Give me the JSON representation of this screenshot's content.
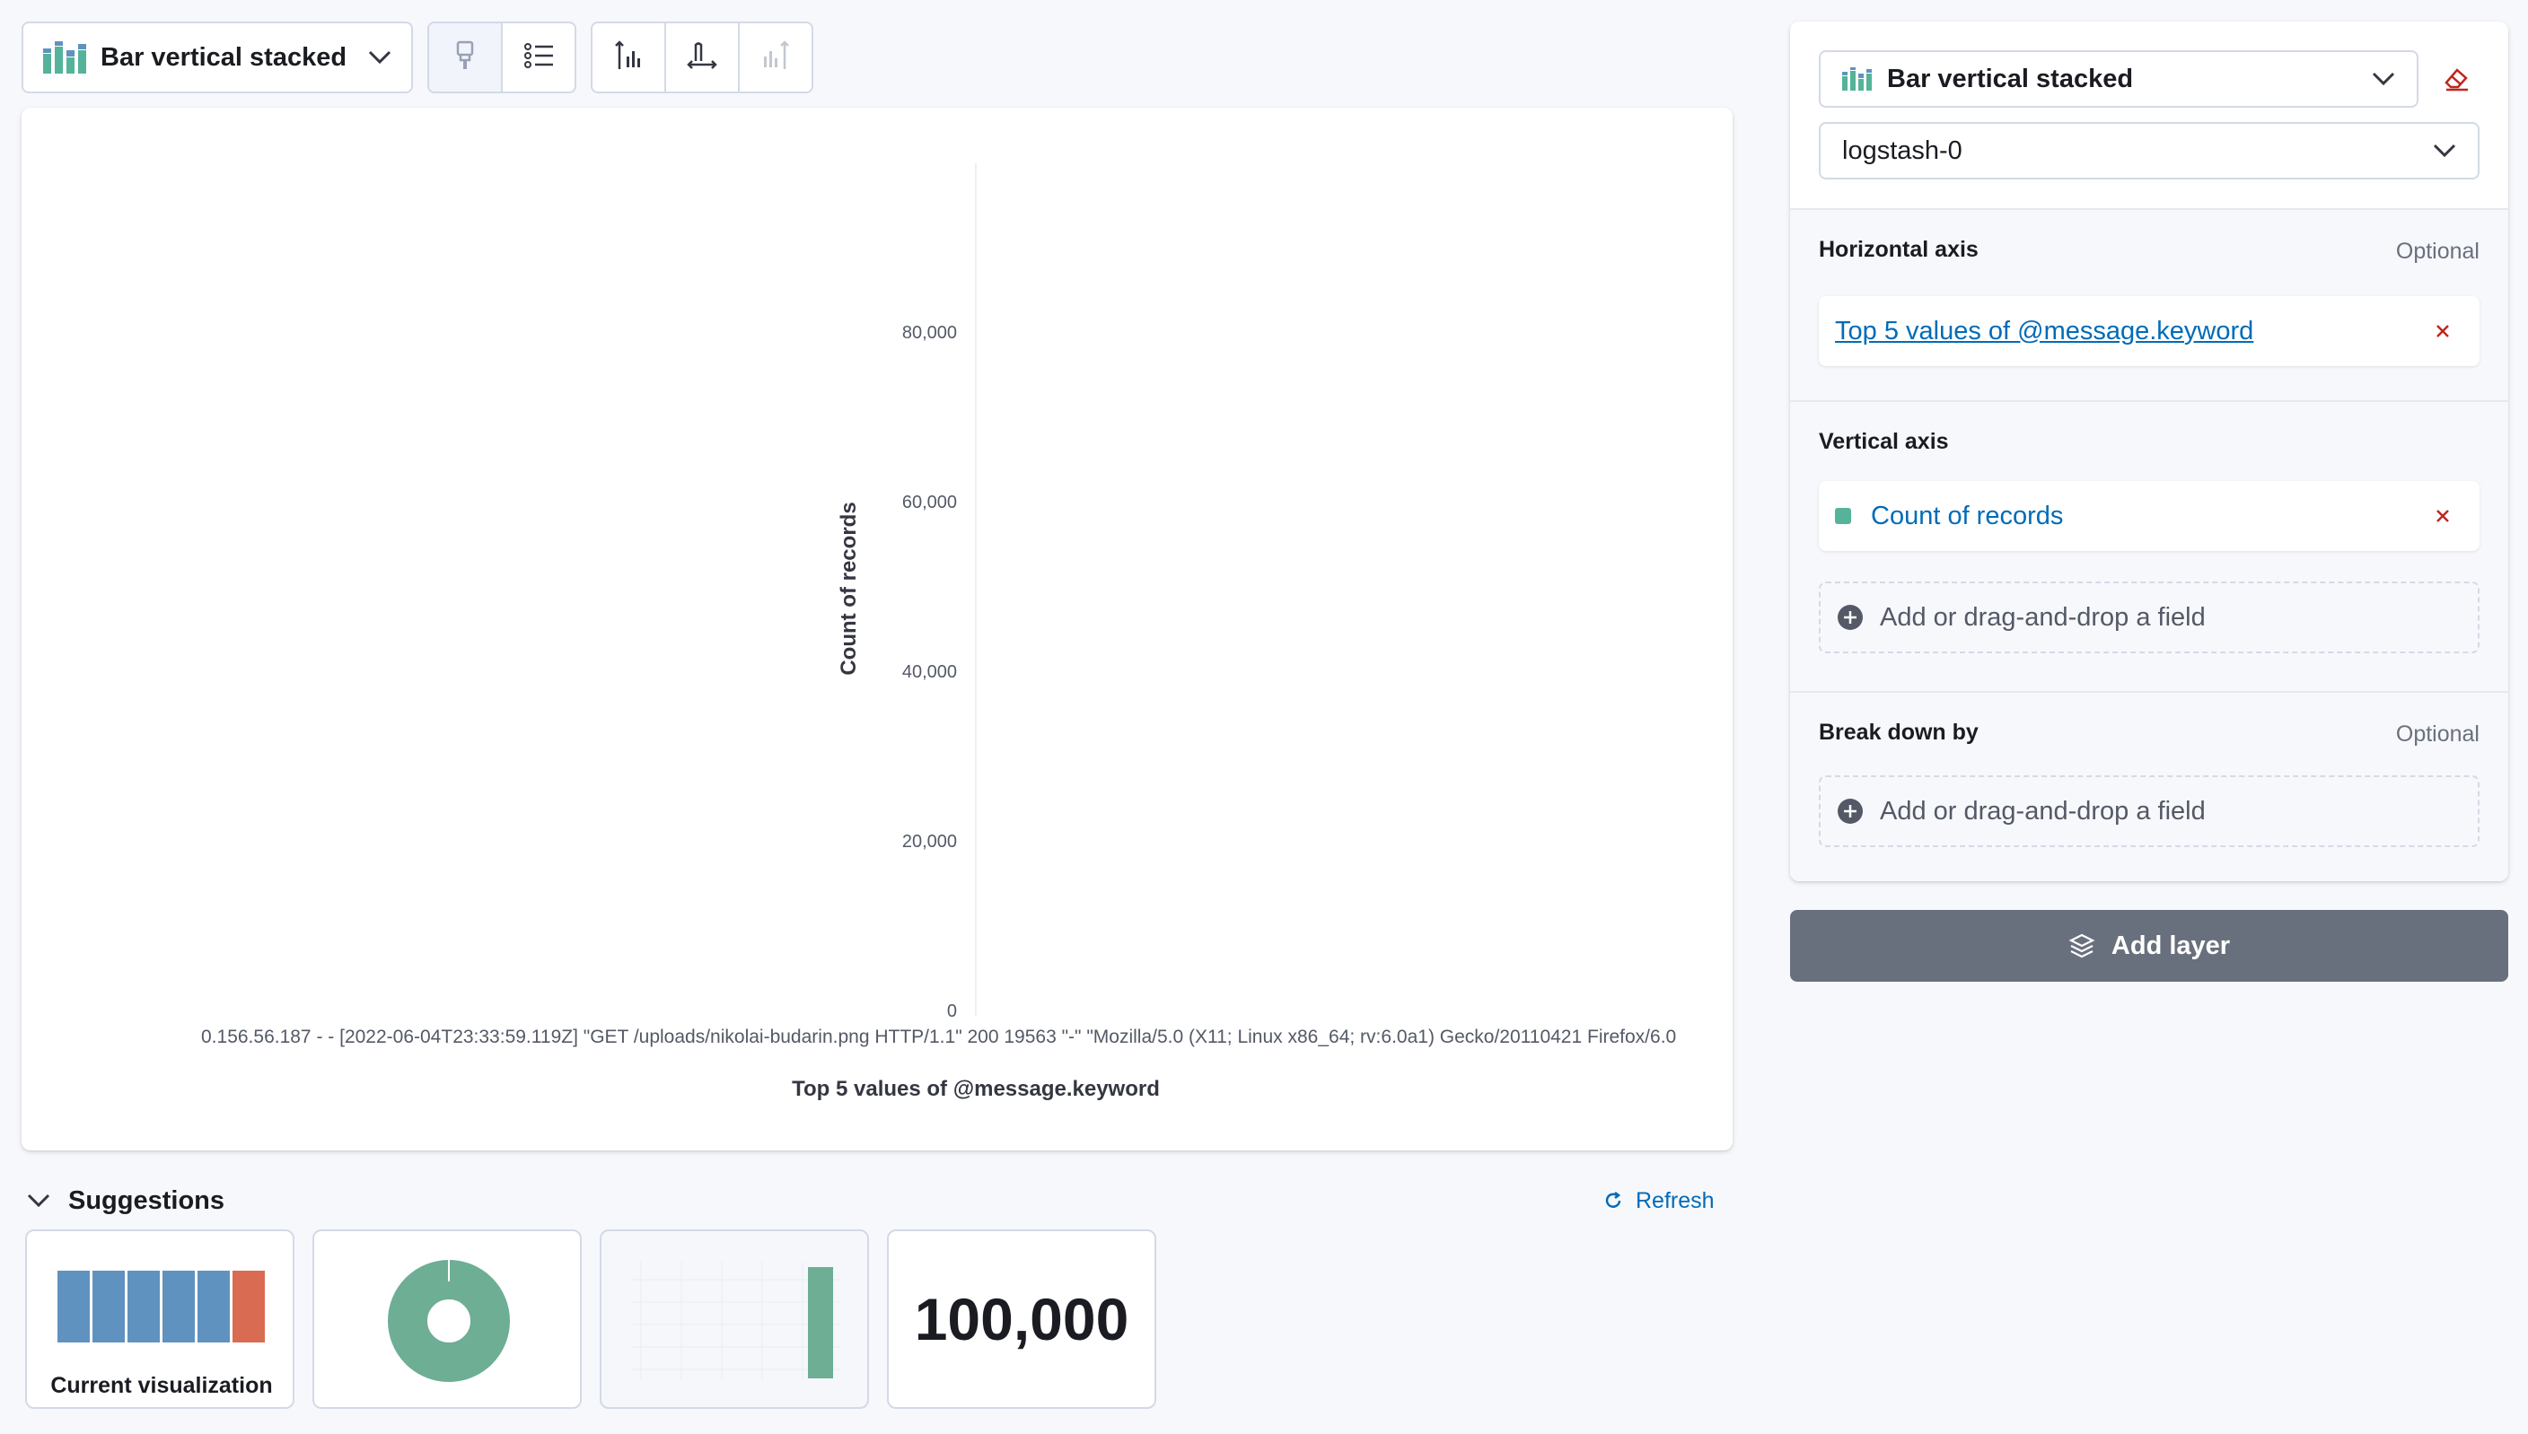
{
  "toolbar": {
    "chart_type_label": "Bar vertical stacked",
    "buttons": [
      {
        "name": "paintbrush-icon"
      },
      {
        "name": "legend-icon"
      },
      {
        "name": "left-axis-icon"
      },
      {
        "name": "bottom-axis-icon"
      },
      {
        "name": "right-axis-icon"
      }
    ]
  },
  "chart": {
    "y_axis_title": "Count of records",
    "y_ticks": [
      "80,000",
      "60,000",
      "40,000",
      "20,000",
      "0"
    ],
    "x_tick_label": "0.156.56.187 - - [2022-06-04T23:33:59.119Z] \"GET /uploads/nikolai-budarin.png HTTP/1.1\" 200 19563 \"-\" \"Mozilla/5.0 (X11; Linux x86_64; rv:6.0a1) Gecko/20110421 Firefox/6.0",
    "x_axis_title": "Top 5 values of @message.keyword"
  },
  "suggestions": {
    "title": "Suggestions",
    "refresh_label": "Refresh",
    "current_label": "Current visualization",
    "metric_value": "100,000"
  },
  "panel": {
    "chart_type_label": "Bar vertical stacked",
    "index_pattern": "logstash-0",
    "horizontal_axis": {
      "title": "Horizontal axis",
      "optional": "Optional",
      "field": "Top 5 values of @message.keyword"
    },
    "vertical_axis": {
      "title": "Vertical axis",
      "field": "Count of records",
      "add_field": "Add or drag-and-drop a field"
    },
    "break_down": {
      "title": "Break down by",
      "optional": "Optional",
      "add_field": "Add or drag-and-drop a field"
    },
    "add_layer_label": "Add layer"
  },
  "colors": {
    "accent_link": "#006bb8",
    "series_green": "#54b399",
    "suggestion_blue": "#6092c0",
    "suggestion_red": "#da8b45",
    "remove_red": "#bd271e",
    "add_layer_bg": "#69707d"
  }
}
